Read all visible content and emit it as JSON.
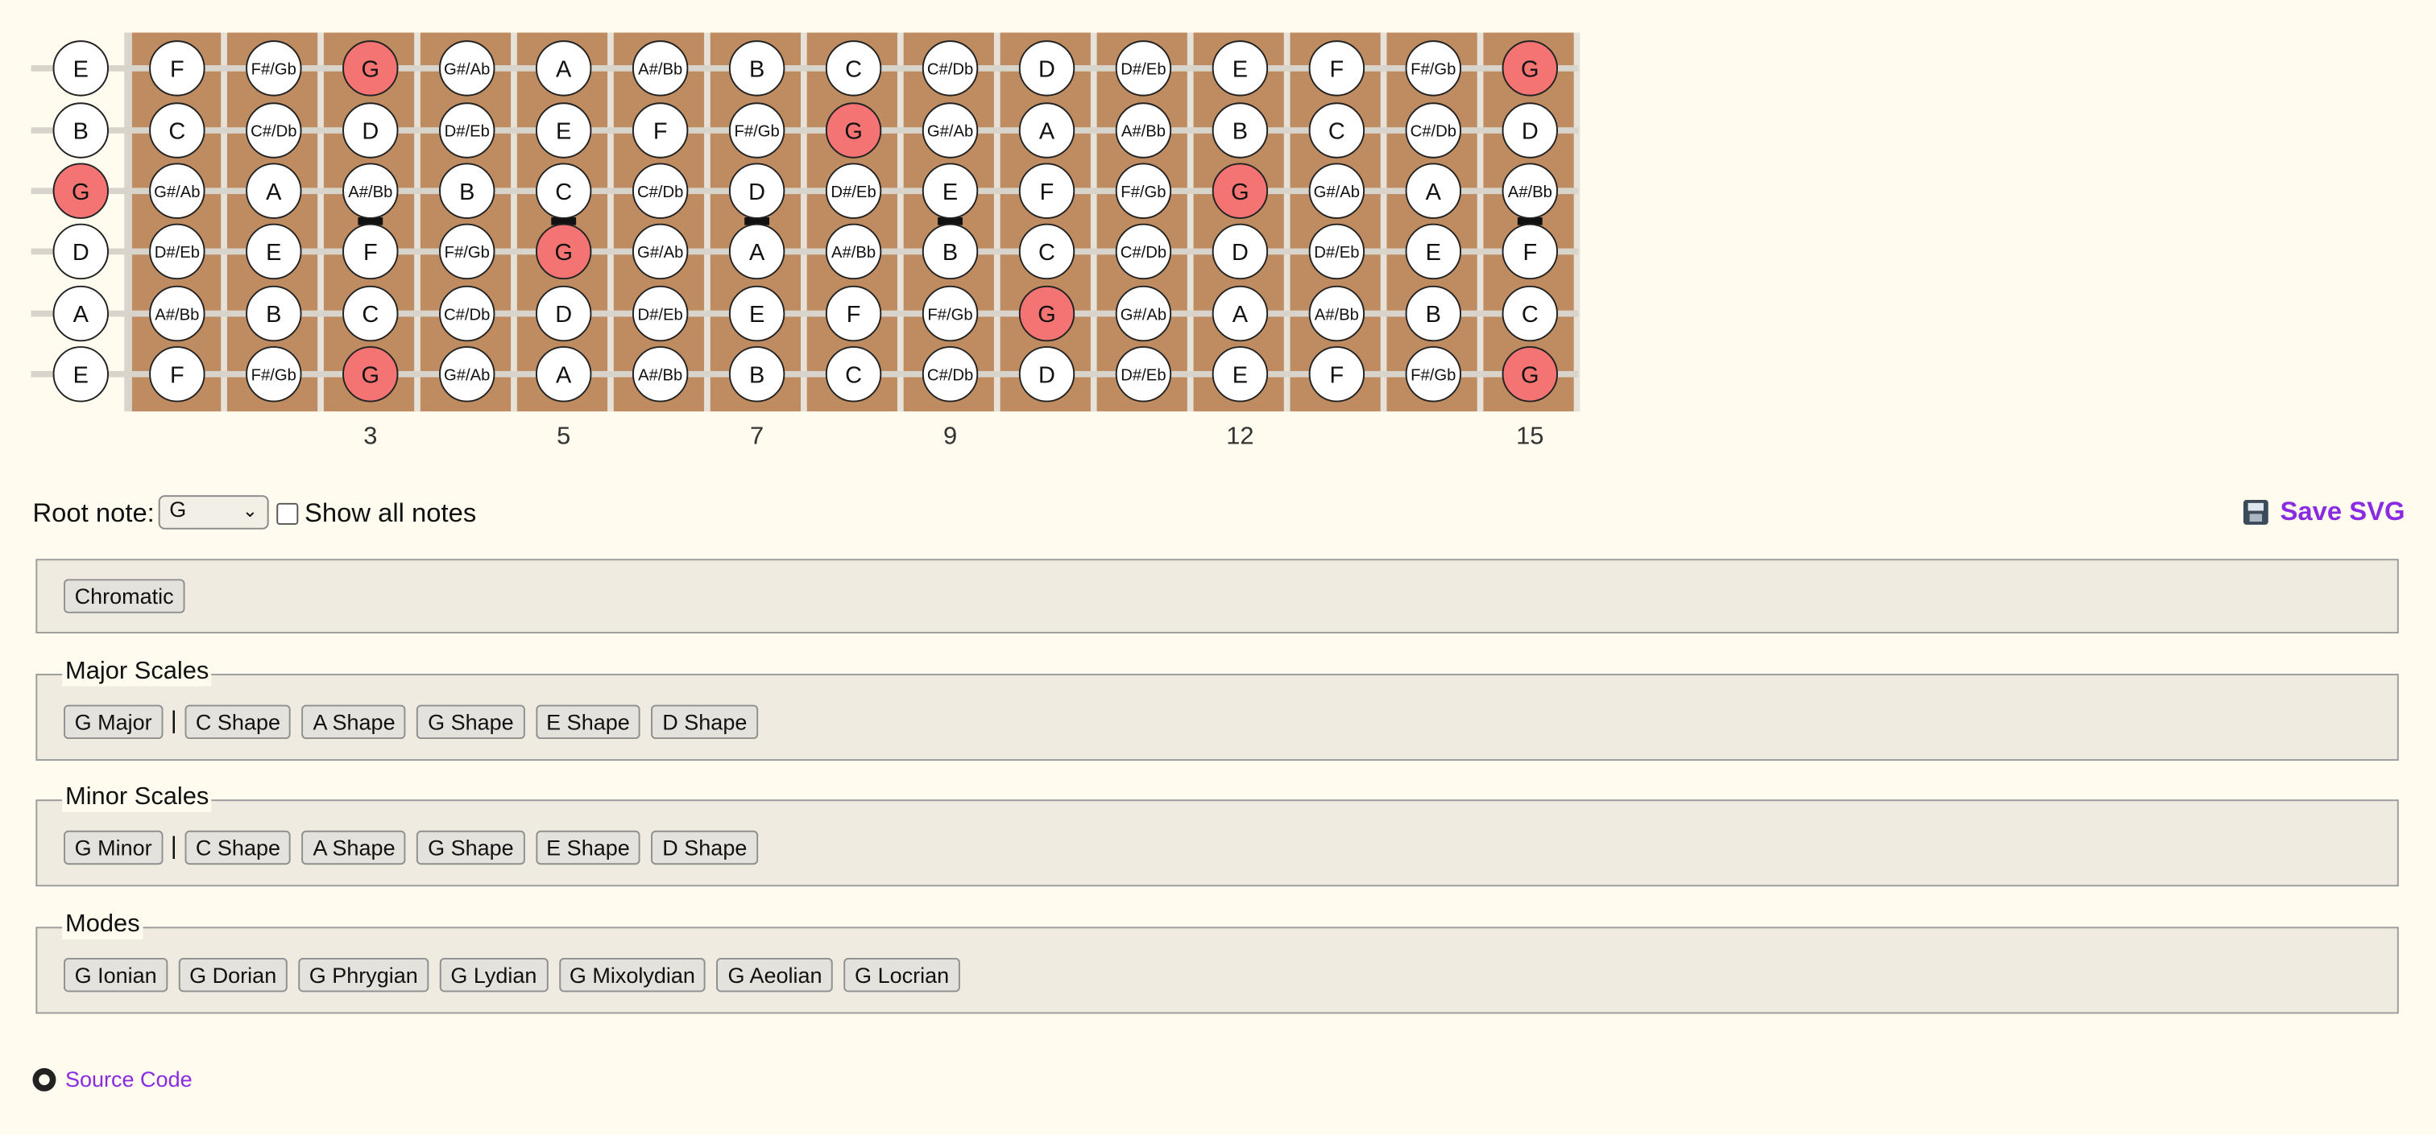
{
  "fretboard": {
    "open_strings": [
      {
        "label": "E",
        "highlighted": false
      },
      {
        "label": "B",
        "highlighted": false
      },
      {
        "label": "G",
        "highlighted": true
      },
      {
        "label": "D",
        "highlighted": false
      },
      {
        "label": "A",
        "highlighted": false
      },
      {
        "label": "E",
        "highlighted": false
      }
    ],
    "strings": [
      [
        "F",
        "F#/Gb",
        "G",
        "G#/Ab",
        "A",
        "A#/Bb",
        "B",
        "C",
        "C#/Db",
        "D",
        "D#/Eb",
        "E",
        "F",
        "F#/Gb",
        "G"
      ],
      [
        "C",
        "C#/Db",
        "D",
        "D#/Eb",
        "E",
        "F",
        "F#/Gb",
        "G",
        "G#/Ab",
        "A",
        "A#/Bb",
        "B",
        "C",
        "C#/Db",
        "D"
      ],
      [
        "G#/Ab",
        "A",
        "A#/Bb",
        "B",
        "C",
        "C#/Db",
        "D",
        "D#/Eb",
        "E",
        "F",
        "F#/Gb",
        "G",
        "G#/Ab",
        "A",
        "A#/Bb"
      ],
      [
        "D#/Eb",
        "E",
        "F",
        "F#/Gb",
        "G",
        "G#/Ab",
        "A",
        "A#/Bb",
        "B",
        "C",
        "C#/Db",
        "D",
        "D#/Eb",
        "E",
        "F"
      ],
      [
        "A#/Bb",
        "B",
        "C",
        "C#/Db",
        "D",
        "D#/Eb",
        "E",
        "F",
        "F#/Gb",
        "G",
        "G#/Ab",
        "A",
        "A#/Bb",
        "B",
        "C"
      ],
      [
        "F",
        "F#/Gb",
        "G",
        "G#/Ab",
        "A",
        "A#/Bb",
        "B",
        "C",
        "C#/Db",
        "D",
        "D#/Eb",
        "E",
        "F",
        "F#/Gb",
        "G"
      ]
    ],
    "highlight_note": "G",
    "fret_number_labels": [
      {
        "fret": 3,
        "label": "3"
      },
      {
        "fret": 5,
        "label": "5"
      },
      {
        "fret": 7,
        "label": "7"
      },
      {
        "fret": 9,
        "label": "9"
      },
      {
        "fret": 12,
        "label": "12"
      },
      {
        "fret": 15,
        "label": "15"
      }
    ],
    "inlay_frets": [
      3,
      5,
      7,
      9,
      15
    ],
    "colors": {
      "wood": "#bf8c62",
      "highlight": "#f47474",
      "string": "#d8d4cc",
      "fret": "#e6e2da",
      "nut": "#d9d5cc"
    }
  },
  "controls": {
    "root_label": "Root note:",
    "root_value": "G",
    "show_all_label": "Show all notes",
    "show_all_checked": false,
    "save_label": "Save SVG"
  },
  "chromatic": {
    "button": "Chromatic"
  },
  "major": {
    "legend": "Major Scales",
    "main": "G Major",
    "separator": "|",
    "shapes": [
      "C Shape",
      "A Shape",
      "G Shape",
      "E Shape",
      "D Shape"
    ]
  },
  "minor": {
    "legend": "Minor Scales",
    "main": "G Minor",
    "separator": "|",
    "shapes": [
      "C Shape",
      "A Shape",
      "G Shape",
      "E Shape",
      "D Shape"
    ]
  },
  "modes": {
    "legend": "Modes",
    "items": [
      "G Ionian",
      "G Dorian",
      "G Phrygian",
      "G Lydian",
      "G Mixolydian",
      "G Aeolian",
      "G Locrian"
    ]
  },
  "footer": {
    "source_label": "Source Code"
  }
}
